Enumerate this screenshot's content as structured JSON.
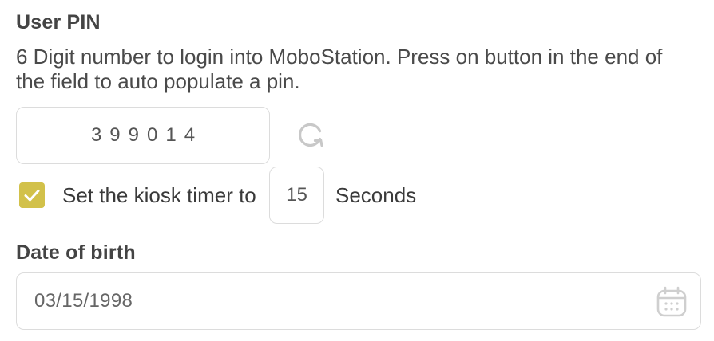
{
  "user_pin": {
    "title": "User PIN",
    "description": "6 Digit number to login into MoboStation. Press on button in the end of the field to auto populate a pin.",
    "value": "399014",
    "refresh_icon": "refresh-icon"
  },
  "kiosk_timer": {
    "checked": true,
    "label_before": "Set the kiosk timer to",
    "value": "15",
    "label_after": "Seconds",
    "accent_color": "#d2c14a"
  },
  "date_of_birth": {
    "title": "Date of birth",
    "value": "03/15/1998",
    "calendar_icon": "calendar-icon"
  }
}
